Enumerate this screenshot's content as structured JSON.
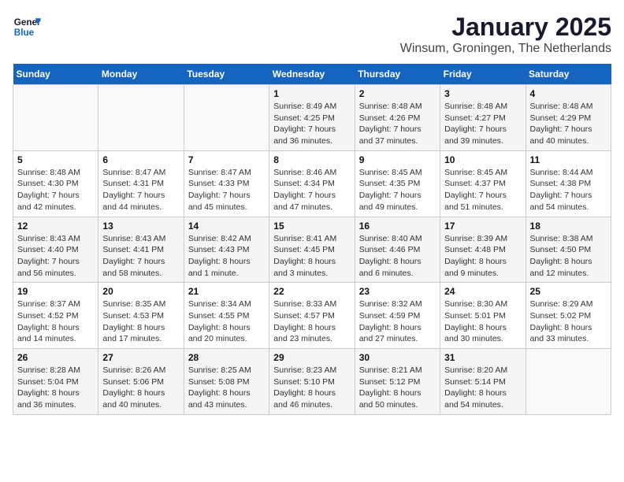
{
  "logo": {
    "line1": "General",
    "line2": "Blue"
  },
  "title": "January 2025",
  "subtitle": "Winsum, Groningen, The Netherlands",
  "days_of_week": [
    "Sunday",
    "Monday",
    "Tuesday",
    "Wednesday",
    "Thursday",
    "Friday",
    "Saturday"
  ],
  "weeks": [
    [
      {
        "day": "",
        "info": ""
      },
      {
        "day": "",
        "info": ""
      },
      {
        "day": "",
        "info": ""
      },
      {
        "day": "1",
        "info": "Sunrise: 8:49 AM\nSunset: 4:25 PM\nDaylight: 7 hours and 36 minutes."
      },
      {
        "day": "2",
        "info": "Sunrise: 8:48 AM\nSunset: 4:26 PM\nDaylight: 7 hours and 37 minutes."
      },
      {
        "day": "3",
        "info": "Sunrise: 8:48 AM\nSunset: 4:27 PM\nDaylight: 7 hours and 39 minutes."
      },
      {
        "day": "4",
        "info": "Sunrise: 8:48 AM\nSunset: 4:29 PM\nDaylight: 7 hours and 40 minutes."
      }
    ],
    [
      {
        "day": "5",
        "info": "Sunrise: 8:48 AM\nSunset: 4:30 PM\nDaylight: 7 hours and 42 minutes."
      },
      {
        "day": "6",
        "info": "Sunrise: 8:47 AM\nSunset: 4:31 PM\nDaylight: 7 hours and 44 minutes."
      },
      {
        "day": "7",
        "info": "Sunrise: 8:47 AM\nSunset: 4:33 PM\nDaylight: 7 hours and 45 minutes."
      },
      {
        "day": "8",
        "info": "Sunrise: 8:46 AM\nSunset: 4:34 PM\nDaylight: 7 hours and 47 minutes."
      },
      {
        "day": "9",
        "info": "Sunrise: 8:45 AM\nSunset: 4:35 PM\nDaylight: 7 hours and 49 minutes."
      },
      {
        "day": "10",
        "info": "Sunrise: 8:45 AM\nSunset: 4:37 PM\nDaylight: 7 hours and 51 minutes."
      },
      {
        "day": "11",
        "info": "Sunrise: 8:44 AM\nSunset: 4:38 PM\nDaylight: 7 hours and 54 minutes."
      }
    ],
    [
      {
        "day": "12",
        "info": "Sunrise: 8:43 AM\nSunset: 4:40 PM\nDaylight: 7 hours and 56 minutes."
      },
      {
        "day": "13",
        "info": "Sunrise: 8:43 AM\nSunset: 4:41 PM\nDaylight: 7 hours and 58 minutes."
      },
      {
        "day": "14",
        "info": "Sunrise: 8:42 AM\nSunset: 4:43 PM\nDaylight: 8 hours and 1 minute."
      },
      {
        "day": "15",
        "info": "Sunrise: 8:41 AM\nSunset: 4:45 PM\nDaylight: 8 hours and 3 minutes."
      },
      {
        "day": "16",
        "info": "Sunrise: 8:40 AM\nSunset: 4:46 PM\nDaylight: 8 hours and 6 minutes."
      },
      {
        "day": "17",
        "info": "Sunrise: 8:39 AM\nSunset: 4:48 PM\nDaylight: 8 hours and 9 minutes."
      },
      {
        "day": "18",
        "info": "Sunrise: 8:38 AM\nSunset: 4:50 PM\nDaylight: 8 hours and 12 minutes."
      }
    ],
    [
      {
        "day": "19",
        "info": "Sunrise: 8:37 AM\nSunset: 4:52 PM\nDaylight: 8 hours and 14 minutes."
      },
      {
        "day": "20",
        "info": "Sunrise: 8:35 AM\nSunset: 4:53 PM\nDaylight: 8 hours and 17 minutes."
      },
      {
        "day": "21",
        "info": "Sunrise: 8:34 AM\nSunset: 4:55 PM\nDaylight: 8 hours and 20 minutes."
      },
      {
        "day": "22",
        "info": "Sunrise: 8:33 AM\nSunset: 4:57 PM\nDaylight: 8 hours and 23 minutes."
      },
      {
        "day": "23",
        "info": "Sunrise: 8:32 AM\nSunset: 4:59 PM\nDaylight: 8 hours and 27 minutes."
      },
      {
        "day": "24",
        "info": "Sunrise: 8:30 AM\nSunset: 5:01 PM\nDaylight: 8 hours and 30 minutes."
      },
      {
        "day": "25",
        "info": "Sunrise: 8:29 AM\nSunset: 5:02 PM\nDaylight: 8 hours and 33 minutes."
      }
    ],
    [
      {
        "day": "26",
        "info": "Sunrise: 8:28 AM\nSunset: 5:04 PM\nDaylight: 8 hours and 36 minutes."
      },
      {
        "day": "27",
        "info": "Sunrise: 8:26 AM\nSunset: 5:06 PM\nDaylight: 8 hours and 40 minutes."
      },
      {
        "day": "28",
        "info": "Sunrise: 8:25 AM\nSunset: 5:08 PM\nDaylight: 8 hours and 43 minutes."
      },
      {
        "day": "29",
        "info": "Sunrise: 8:23 AM\nSunset: 5:10 PM\nDaylight: 8 hours and 46 minutes."
      },
      {
        "day": "30",
        "info": "Sunrise: 8:21 AM\nSunset: 5:12 PM\nDaylight: 8 hours and 50 minutes."
      },
      {
        "day": "31",
        "info": "Sunrise: 8:20 AM\nSunset: 5:14 PM\nDaylight: 8 hours and 54 minutes."
      },
      {
        "day": "",
        "info": ""
      }
    ]
  ]
}
